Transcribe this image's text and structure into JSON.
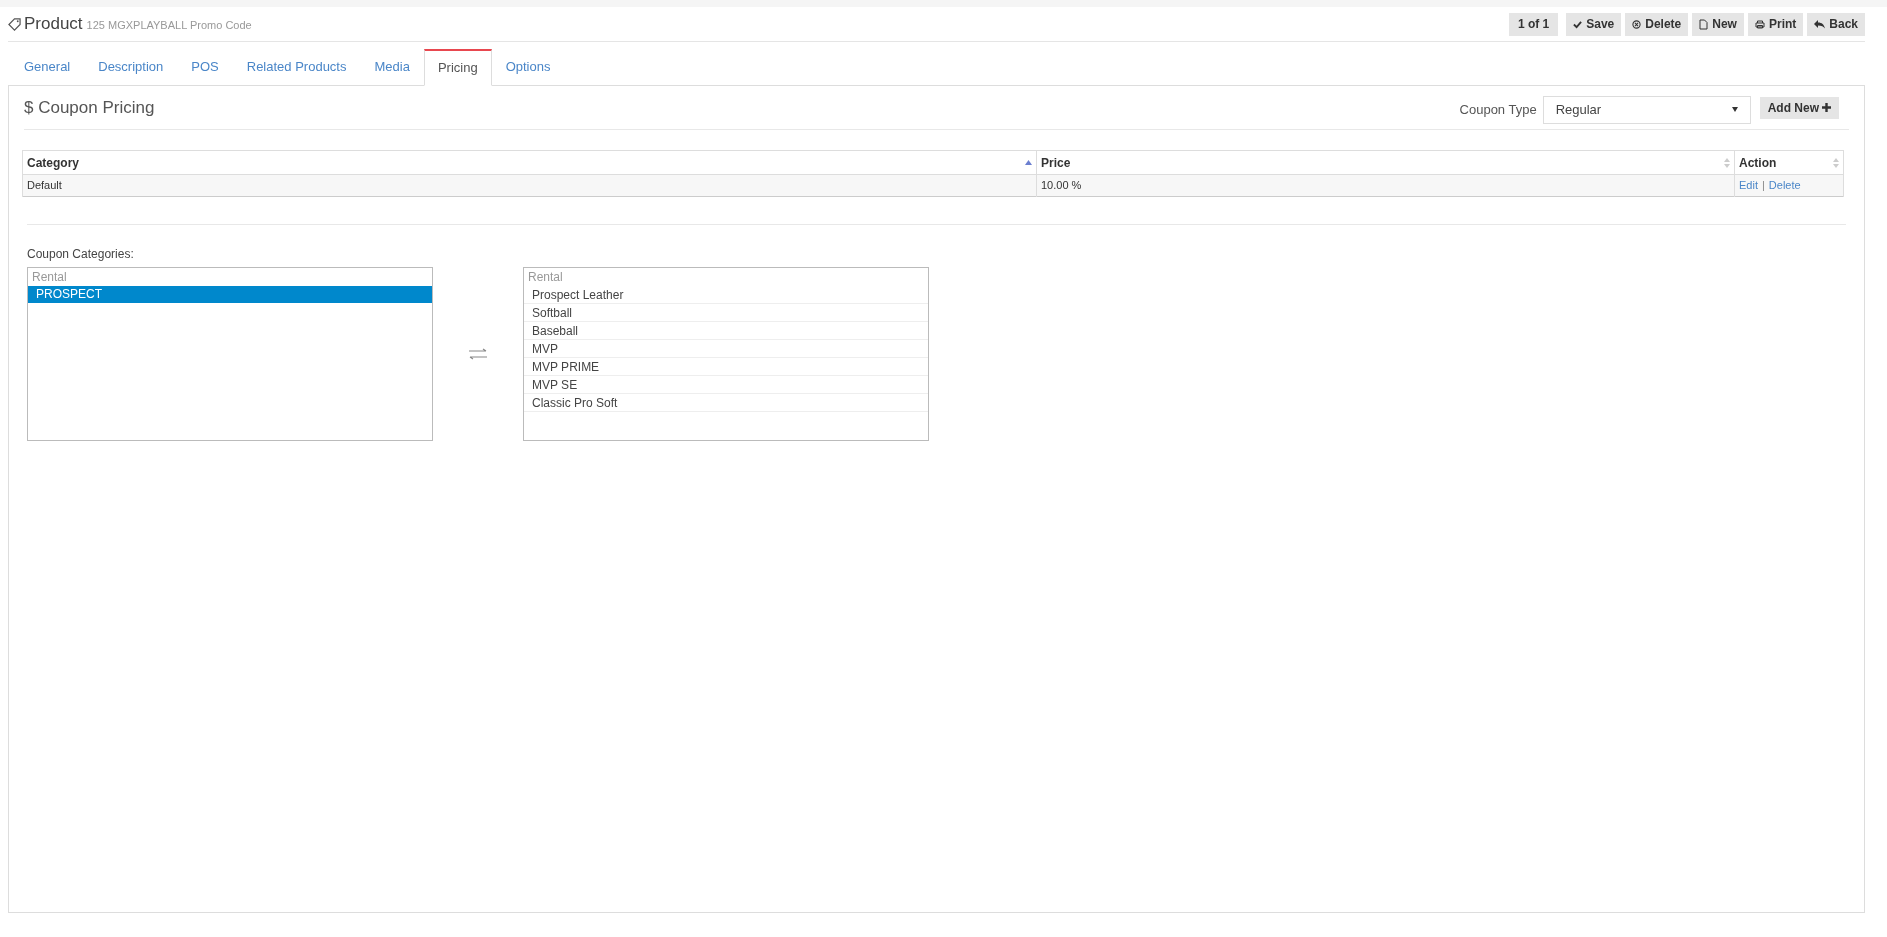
{
  "header": {
    "title": "Product",
    "subtitle": "125 MGXPLAYBALL Promo Code"
  },
  "toolbar": {
    "pager": "1 of 1",
    "buttons": [
      {
        "kind": "save",
        "label": "Save"
      },
      {
        "kind": "delete",
        "label": "Delete"
      },
      {
        "kind": "new",
        "label": "New"
      },
      {
        "kind": "print",
        "label": "Print"
      },
      {
        "kind": "back",
        "label": "Back"
      }
    ]
  },
  "tabs": [
    {
      "label": "General",
      "selected": false
    },
    {
      "label": "Description",
      "selected": false
    },
    {
      "label": "POS",
      "selected": false
    },
    {
      "label": "Related Products",
      "selected": false
    },
    {
      "label": "Media",
      "selected": false
    },
    {
      "label": "Pricing",
      "selected": true
    },
    {
      "label": "Options",
      "selected": false
    }
  ],
  "section": {
    "title": "$ Coupon Pricing",
    "coupon_type_label": "Coupon Type",
    "coupon_type_value": "Regular",
    "add_button": "Add New"
  },
  "table": {
    "columns": [
      {
        "label": "Category",
        "sorted": true
      },
      {
        "label": "Price",
        "sorted": false
      },
      {
        "label": "Action",
        "sorted": false
      }
    ],
    "rows": [
      {
        "category": "Default",
        "price": "10.00 %",
        "actions": [
          "Edit",
          "Delete"
        ],
        "separator": "|"
      }
    ]
  },
  "categories": {
    "label": "Coupon Categories:",
    "left": {
      "group": "Rental",
      "items": [
        {
          "label": "PROSPECT",
          "selected": true
        }
      ]
    },
    "right": {
      "group": "Rental",
      "items": [
        {
          "label": "Prospect Leather",
          "selected": false
        },
        {
          "label": "Softball",
          "selected": false
        },
        {
          "label": "Baseball",
          "selected": false
        },
        {
          "label": "MVP",
          "selected": false
        },
        {
          "label": "MVP PRIME",
          "selected": false
        },
        {
          "label": "MVP SE",
          "selected": false
        },
        {
          "label": "Classic Pro Soft",
          "selected": false
        }
      ]
    }
  }
}
